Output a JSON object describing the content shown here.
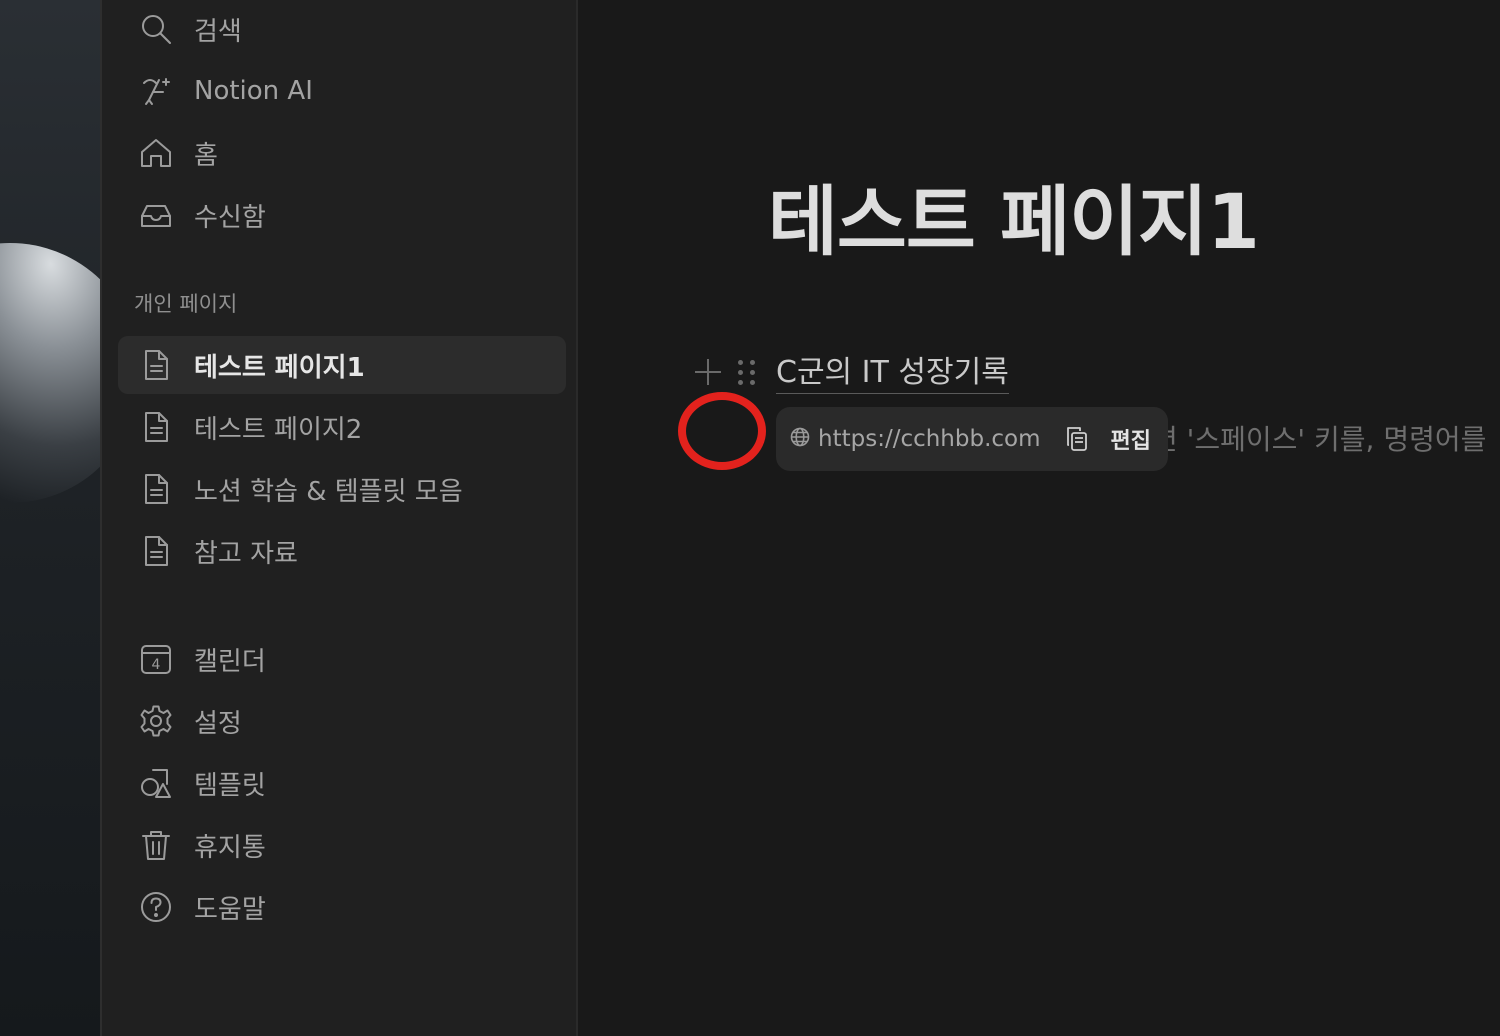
{
  "sidebar": {
    "top_items": [
      {
        "label": "검색",
        "icon": "search-icon"
      },
      {
        "label": "Notion AI",
        "icon": "notion-ai-icon"
      },
      {
        "label": "홈",
        "icon": "home-icon"
      },
      {
        "label": "수신함",
        "icon": "inbox-icon"
      }
    ],
    "section_title": "개인 페이지",
    "pages": [
      {
        "label": "테스트 페이지1",
        "icon": "page-icon",
        "active": true
      },
      {
        "label": "테스트 페이지2",
        "icon": "page-icon",
        "active": false
      },
      {
        "label": "노션 학습 & 템플릿 모음",
        "icon": "page-icon",
        "active": false
      },
      {
        "label": "참고 자료",
        "icon": "page-icon",
        "active": false
      }
    ],
    "bottom_items": [
      {
        "label": "캘린더",
        "icon": "calendar-icon",
        "badge": "4"
      },
      {
        "label": "설정",
        "icon": "gear-icon"
      },
      {
        "label": "템플릿",
        "icon": "template-icon"
      },
      {
        "label": "휴지통",
        "icon": "trash-icon"
      },
      {
        "label": "도움말",
        "icon": "help-icon"
      }
    ]
  },
  "main": {
    "page_title": "테스트 페이지1",
    "link_block_text": "C군의 IT 성장기록",
    "placeholder_text": "면 '스페이스' 키를, 명령어를",
    "link_popup": {
      "url": "https://cchhbb.com",
      "edit_label": "편집"
    }
  },
  "colors": {
    "background": "#191919",
    "sidebar": "#202020",
    "annotation_ring": "#e3221d"
  }
}
